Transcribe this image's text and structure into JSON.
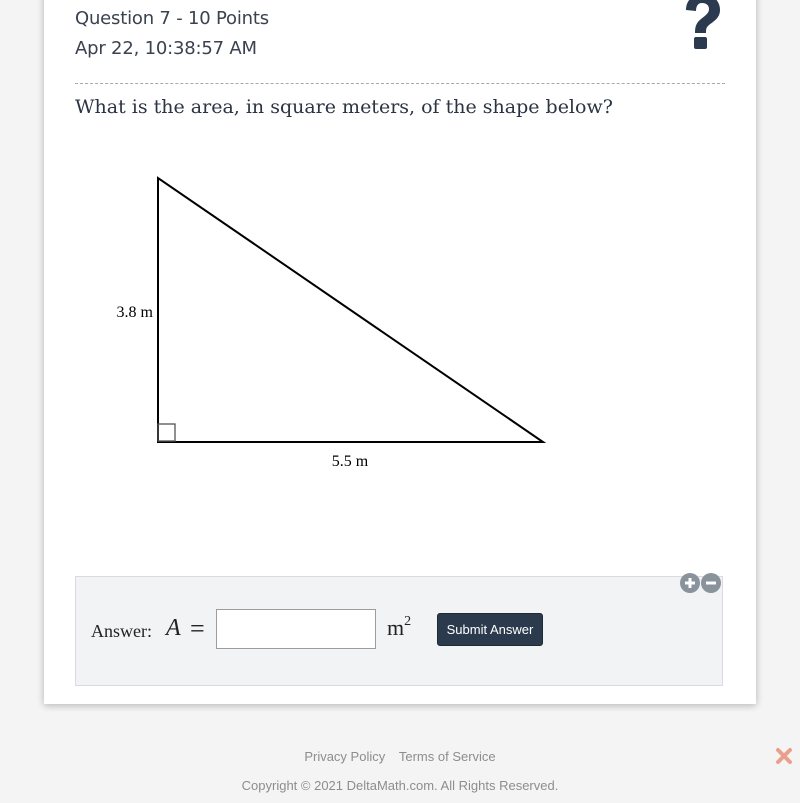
{
  "header": {
    "question_label": "Question 7 - 10 Points",
    "timestamp": "Apr 22, 10:38:57 AM",
    "help_icon": "question-mark-icon"
  },
  "question": {
    "prompt": "What is the area, in square meters, of the shape below?",
    "figure": {
      "shape": "right-triangle",
      "height_label": "3.8 m",
      "base_label": "5.5 m",
      "right_angle_marker": true
    }
  },
  "answer": {
    "label": "Answer:",
    "variable": "A",
    "equals": "=",
    "input_value": "",
    "input_placeholder": "",
    "unit_base": "m",
    "unit_exponent": "2",
    "submit_label": "Submit Answer",
    "zoom_in_icon": "plus-circle-icon",
    "zoom_out_icon": "minus-circle-icon"
  },
  "footer": {
    "links": [
      "Privacy Policy",
      "Terms of Service"
    ],
    "copyright": "Copyright © 2021 DeltaMath.com. All Rights Reserved.",
    "close_icon": "close-x-icon"
  },
  "colors": {
    "button_bg": "#2c3a4d",
    "help_icon": "#2b3a4e",
    "close_icon": "#e8a08c",
    "answer_bg": "#f2f3f5"
  }
}
